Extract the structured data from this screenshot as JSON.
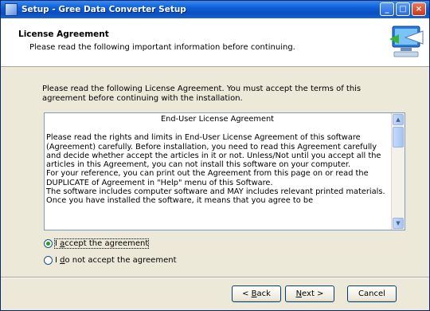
{
  "window": {
    "title": "Setup - Gree Data Converter Setup",
    "controls": [
      "minimize-icon",
      "maximize-icon",
      "close-icon"
    ]
  },
  "header": {
    "title": "License Agreement",
    "subtitle": "Please read the following important information before continuing."
  },
  "intro": "Please read the following License Agreement. You must accept the terms of this agreement before continuing with the installation.",
  "eula": {
    "title": "End-User License Agreement",
    "paragraphs": [
      "Please read the rights and limits in End-User License Agreement of this software (Agreement) carefully. Before installation, you need to read this Agreement carefully and decide whether accept the articles in it or not. Unless/Not until you accept all the articles in this Agreement, you can not install this software on your computer.",
      "For your reference, you can print out the Agreement from this page on or read the DUPLICATE of Agreement in \"Help\" menu of this Software.",
      "The software includes computer software and MAY includes relevant printed materials. Once you have installed the software, it means that you agree to be"
    ]
  },
  "radios": {
    "accept": {
      "prefix": "I ",
      "accel": "a",
      "rest": "ccept the agreement",
      "checked": true
    },
    "decline": {
      "prefix": "I ",
      "accel": "d",
      "rest": "o not accept the agreement",
      "checked": false
    }
  },
  "buttons": {
    "back": {
      "prefix": "< ",
      "accel": "B",
      "rest": "ack"
    },
    "next": {
      "prefix": "",
      "accel": "N",
      "rest": "ext >"
    },
    "cancel": {
      "label": "Cancel"
    }
  },
  "colors": {
    "titlebar": "#0c5fd8",
    "window_bg": "#ece9d8",
    "radio_dot": "#21a121"
  }
}
